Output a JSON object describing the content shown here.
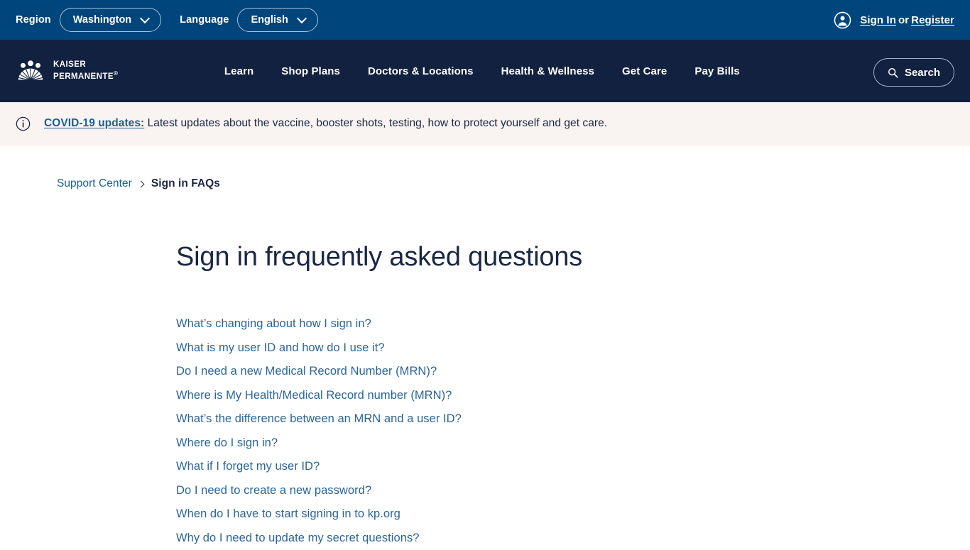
{
  "utility_bar": {
    "region_label": "Region",
    "region_value": "Washington",
    "language_label": "Language",
    "language_value": "English",
    "sign_in_label": "Sign In",
    "or_label": "or",
    "register_label": "Register",
    "avatar_icon": "user-circle-icon",
    "background_color": "#00457C"
  },
  "brand": {
    "logo_icon": "kaiser-permanente-logo-icon",
    "line1": "KAISER",
    "line2": "PERMANENTE",
    "registered_mark": "®"
  },
  "nav": {
    "background_color": "#12213F",
    "items": [
      {
        "label": "Learn"
      },
      {
        "label": "Shop Plans"
      },
      {
        "label": "Doctors & Locations"
      },
      {
        "label": "Health & Wellness"
      },
      {
        "label": "Get Care"
      },
      {
        "label": "Pay Bills"
      }
    ],
    "search_label": "Search",
    "search_icon": "search-icon"
  },
  "alert": {
    "icon": "info-circle-icon",
    "link_text": "COVID-19 updates:",
    "body_text": " Latest updates about the vaccine, booster shots, testing, how to protect yourself and get care.",
    "background_color": "#F9F3F1",
    "link_color": "#1B6094"
  },
  "breadcrumb": {
    "parent": "Support Center",
    "separator": "chevron-right-icon",
    "current": "Sign in FAQs"
  },
  "main": {
    "title": "Sign in frequently asked questions",
    "link_color": "#2A6496",
    "faq_links": [
      {
        "label": "What’s changing about how I sign in?"
      },
      {
        "label": "What is my user ID and how do I use it?"
      },
      {
        "label": "Do I need a new Medical Record Number (MRN)?"
      },
      {
        "label": "Where is My Health/Medical Record number (MRN)?"
      },
      {
        "label": "What’s the difference between an MRN and a user ID?"
      },
      {
        "label": "Where do I sign in?"
      },
      {
        "label": "What if I forget my user ID?"
      },
      {
        "label": "Do I need to create a new password?"
      },
      {
        "label": "When do I have to start signing in to kp.org"
      },
      {
        "label": "Why do I need to update my secret questions?"
      }
    ]
  }
}
